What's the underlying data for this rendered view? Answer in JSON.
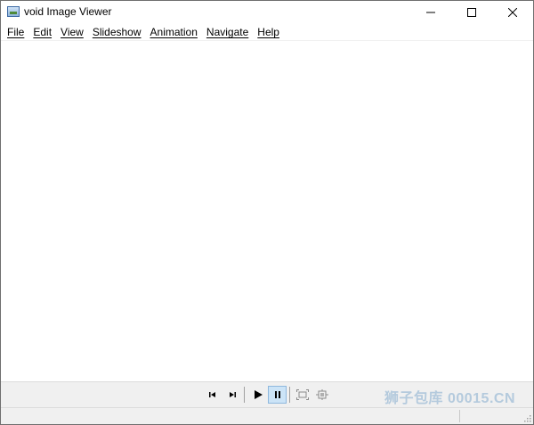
{
  "window": {
    "title": "void Image Viewer",
    "controls": {
      "minimize_icon": "minimize-icon",
      "maximize_icon": "maximize-icon",
      "close_icon": "close-icon"
    }
  },
  "menu": {
    "items": [
      {
        "label": "File"
      },
      {
        "label": "Edit"
      },
      {
        "label": "View"
      },
      {
        "label": "Slideshow"
      },
      {
        "label": "Animation"
      },
      {
        "label": "Navigate"
      },
      {
        "label": "Help"
      }
    ]
  },
  "toolbar": {
    "buttons": [
      {
        "icon": "skip-previous-icon",
        "active": false
      },
      {
        "icon": "skip-next-icon",
        "active": false
      },
      {
        "icon": "play-icon",
        "active": false
      },
      {
        "icon": "pause-icon",
        "active": true
      },
      {
        "icon": "fit-to-window-icon",
        "active": false
      },
      {
        "icon": "actual-size-icon",
        "active": false
      }
    ],
    "watermark": "狮子包库 00015.CN"
  },
  "colors": {
    "toolbar_bg": "#f0f0f0",
    "active_button_bg": "#cce4f7",
    "active_button_border": "#8fb8dd"
  }
}
